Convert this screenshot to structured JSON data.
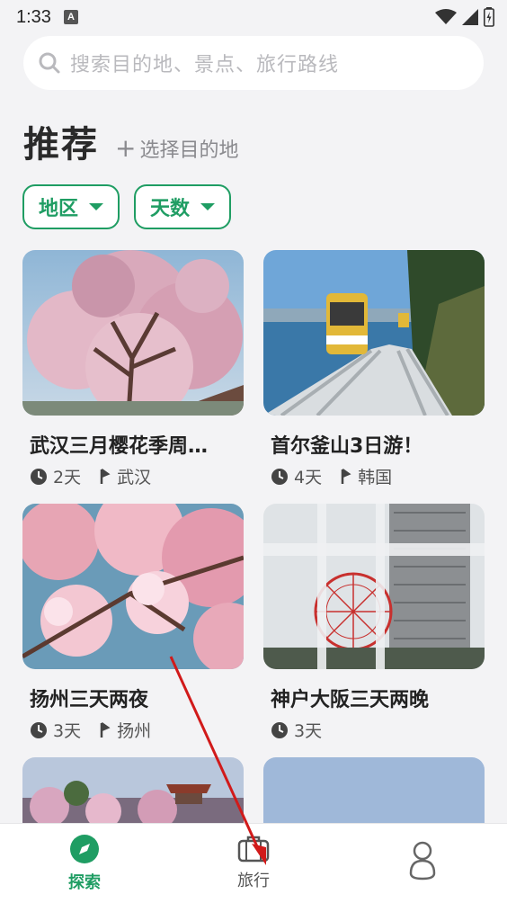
{
  "status": {
    "time": "1:33",
    "notif": "A"
  },
  "search": {
    "placeholder": "搜索目的地、景点、旅行路线"
  },
  "header": {
    "title": "推荐",
    "choose_plus": "+",
    "choose_label": "选择目的地"
  },
  "filters": [
    {
      "label": "地区"
    },
    {
      "label": "天数"
    }
  ],
  "cards": [
    {
      "title": "武汉三月樱花季周…",
      "days": "2天",
      "place": "武汉"
    },
    {
      "title": "首尔釜山3日游！",
      "days": "4天",
      "place": "韩国"
    },
    {
      "title": "扬州三天两夜",
      "days": "3天",
      "place": "扬州"
    },
    {
      "title": "神户大阪三天两晚",
      "days": "3天",
      "place": ""
    }
  ],
  "nav": [
    {
      "label": "探索",
      "icon": "compass-icon",
      "active": true
    },
    {
      "label": "旅行",
      "icon": "suitcase-icon",
      "active": false
    },
    {
      "label": "",
      "icon": "profile-icon",
      "active": false
    }
  ],
  "colors": {
    "accent": "#1f9d63",
    "background": "#f3f3f5",
    "annotation_arrow": "#d11a1a"
  }
}
